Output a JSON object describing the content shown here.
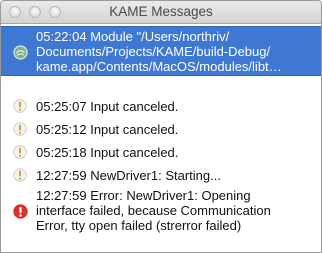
{
  "window": {
    "title": "KAME Messages"
  },
  "messages": [
    {
      "lines": [
        "05:22:04 Module \"/Users/northriv/",
        "Documents/Projects/KAME/build-Debug/",
        "kame.app/Contents/MacOS/modules/libt…"
      ],
      "icon": "module-icon",
      "selected": true
    },
    {
      "lines": [
        "05:25:07 Input canceled."
      ],
      "icon": "warning-icon",
      "selected": false
    },
    {
      "lines": [
        "05:25:12 Input canceled."
      ],
      "icon": "warning-icon",
      "selected": false
    },
    {
      "lines": [
        "05:25:18 Input canceled."
      ],
      "icon": "warning-icon",
      "selected": false
    },
    {
      "lines": [
        "12:27:59 NewDriver1: Starting..."
      ],
      "icon": "warning-icon",
      "selected": false
    },
    {
      "lines": [
        "12:27:59 Error: NewDriver1: Opening",
        "interface failed, because Communication",
        "Error, tty open failed (strerror failed)"
      ],
      "icon": "error-icon",
      "selected": false
    }
  ],
  "colors": {
    "selection": "#3f78d2",
    "error": "#e03327",
    "warning_mark": "#e0a030"
  }
}
